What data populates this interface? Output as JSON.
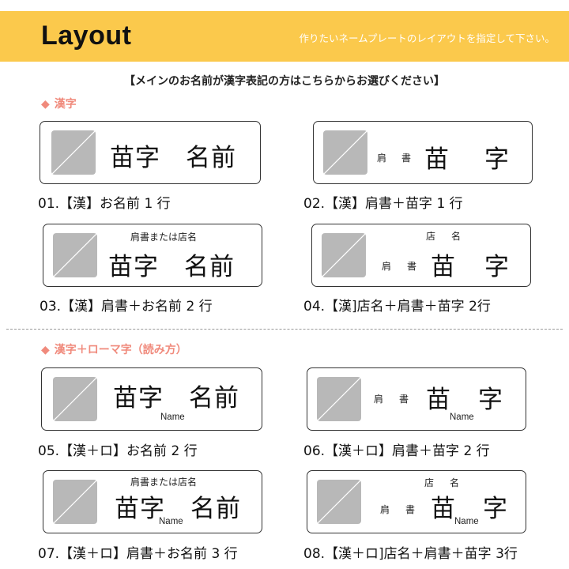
{
  "header": {
    "title": "Layout",
    "description": "作りたいネームプレートのレイアウトを指定して下さい。",
    "color": "#fbc94c"
  },
  "intro": "【メインのお名前が漢字表記の方はこちらからお選びください】",
  "sections": [
    {
      "marker": "◆",
      "label": "漢字"
    },
    {
      "marker": "◆",
      "label": "漢字＋ローマ字（読み方）"
    }
  ],
  "plate_text": {
    "surname": "苗字",
    "given": "名前",
    "full": "苗字　名前",
    "sur_1": "苗",
    "sur_2": "字",
    "title_1": "肩",
    "title_2": "書",
    "title_or_shop": "肩書または店名",
    "shop_1": "店",
    "shop_2": "名",
    "roman": "Name"
  },
  "layouts": [
    {
      "caption": "01.【漢】お名前 1 行"
    },
    {
      "caption": "02.【漢】肩書＋苗字 1 行"
    },
    {
      "caption": "03.【漢】肩書＋お名前 2 行"
    },
    {
      "caption": "04.【漢]店名＋肩書＋苗字 2行"
    },
    {
      "caption": "05.【漢＋ロ】お名前 2 行"
    },
    {
      "caption": "06.【漢＋ロ】肩書＋苗字 2 行"
    },
    {
      "caption": "07.【漢＋ロ】肩書＋お名前 3 行"
    },
    {
      "caption": "08.【漢＋ロ]店名＋肩書＋苗字  3行"
    }
  ],
  "icons": {
    "image_placeholder": "image-placeholder-icon",
    "section_marker": "diamond-icon"
  },
  "colors": {
    "section_label": "#f08a7c",
    "placeholder": "#b8b8b8",
    "border": "#333333"
  }
}
